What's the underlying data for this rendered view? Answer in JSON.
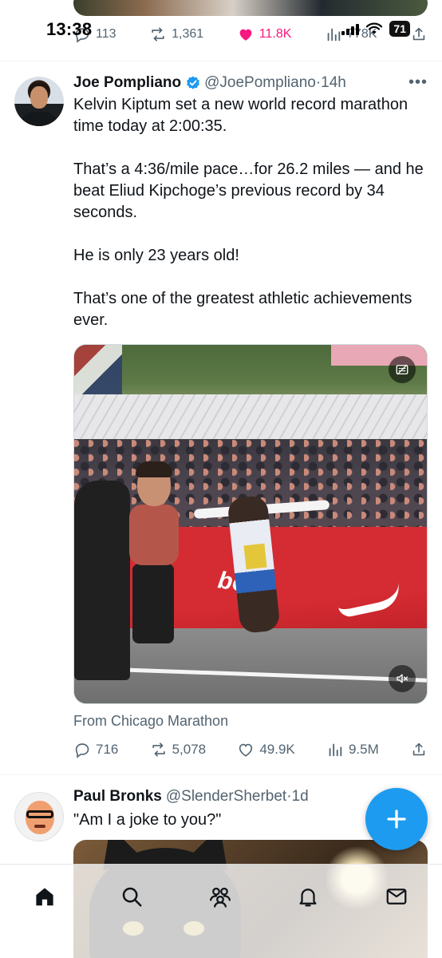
{
  "status_bar": {
    "time": "13:38",
    "battery": "71"
  },
  "previous_tweet": {
    "actions": {
      "replies": "113",
      "reposts": "1,361",
      "likes": "11.8K",
      "views": "778K"
    }
  },
  "tweet": {
    "display_name": "Joe Pompliano",
    "handle": "@JoePompliano",
    "separator": "·",
    "time": "14h",
    "more": "•••",
    "paragraphs": [
      "Kelvin Kiptum set a new world record marathon time today at 2:00:35.",
      "That’s a 4:36/mile pace…for 26.2 miles — and he beat Eliud Kipchoge’s previous record by 34 seconds.",
      "He is only 23 years old!",
      "That’s one of the greatest athletic achievements ever."
    ],
    "source": "From Chicago Marathon",
    "media_text": {
      "banner": "bott"
    },
    "actions": {
      "replies": "716",
      "reposts": "5,078",
      "likes": "49.9K",
      "views": "9.5M"
    }
  },
  "next_tweet": {
    "display_name": "Paul Bronks",
    "handle": "@SlenderSherbet",
    "separator": "·",
    "time": "1d",
    "text": "\"Am I a joke to you?\""
  },
  "colors": {
    "accent": "#1d9bf0",
    "like": "#f91880",
    "secondary_text": "#536471"
  },
  "icons": {
    "tabs": [
      "home-icon",
      "search-icon",
      "communities-icon",
      "notifications-icon",
      "messages-icon"
    ],
    "fab": "compose-plus-icon"
  }
}
